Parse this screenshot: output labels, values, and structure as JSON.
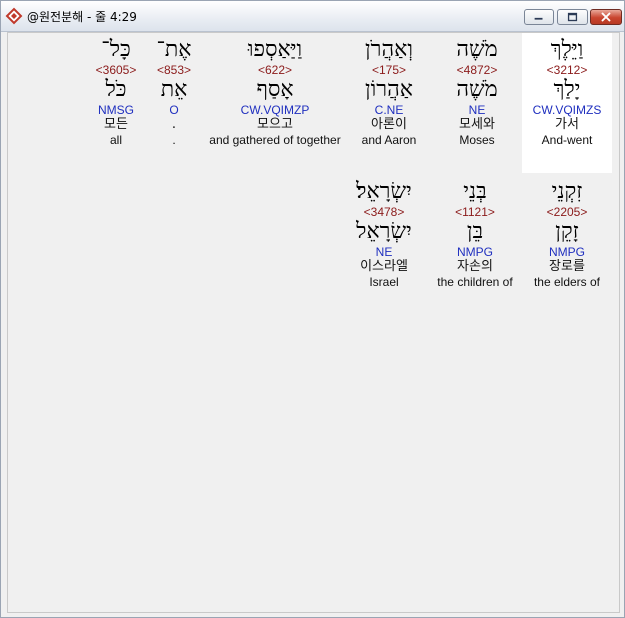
{
  "window": {
    "title": "@원전분해 - 줄 4:29"
  },
  "rows": [
    {
      "words": [
        {
          "hebrew": "וַיֵּלֶךְ",
          "strong": "<3212>",
          "root": "יָלַךְ",
          "parse": "CW.VQIMZS",
          "korean": "가서",
          "english": "And-went",
          "highlight": true
        },
        {
          "hebrew": "מֹשֶׁה",
          "strong": "<4872>",
          "root": "מֹשֶׁה",
          "parse": "NE",
          "korean": "모세와",
          "english": "Moses",
          "highlight": false
        },
        {
          "hebrew": "וְאַהֲרֹן",
          "strong": "<175>",
          "root": "אַהֲרוֹן",
          "parse": "C.NE",
          "korean": "아론이",
          "english": "and Aaron",
          "highlight": false
        },
        {
          "hebrew": "וַיַּאַסְפוּ",
          "strong": "<622>",
          "root": "אָסַף",
          "parse": "CW.VQIMZP",
          "korean": "모으고",
          "english": "and gathered of together",
          "highlight": false
        },
        {
          "hebrew": "אֶת־",
          "strong": "<853>",
          "root": "אֵת",
          "parse": "O",
          "korean": ".",
          "english": ".",
          "highlight": false
        },
        {
          "hebrew": "כָּל־",
          "strong": "<3605>",
          "root": "כֹּל",
          "parse": "NMSG",
          "korean": "모든",
          "english": "all",
          "highlight": false
        }
      ]
    },
    {
      "words": [
        {
          "hebrew": "זִקְנֵי",
          "strong": "<2205>",
          "root": "זָקֵן",
          "parse": "NMPG",
          "korean": "장로를",
          "english": "the elders of",
          "highlight": false
        },
        {
          "hebrew": "בְּנֵי",
          "strong": "<1121>",
          "root": "בֵּן",
          "parse": "NMPG",
          "korean": "자손의",
          "english": "the children of",
          "highlight": false
        },
        {
          "hebrew": "יִשְׂרָאֵל׃",
          "strong": "<3478>",
          "root": "יִשְׂרָאֵל",
          "parse": "NE",
          "korean": "이스라엘",
          "english": "Israel",
          "highlight": false
        }
      ]
    }
  ]
}
